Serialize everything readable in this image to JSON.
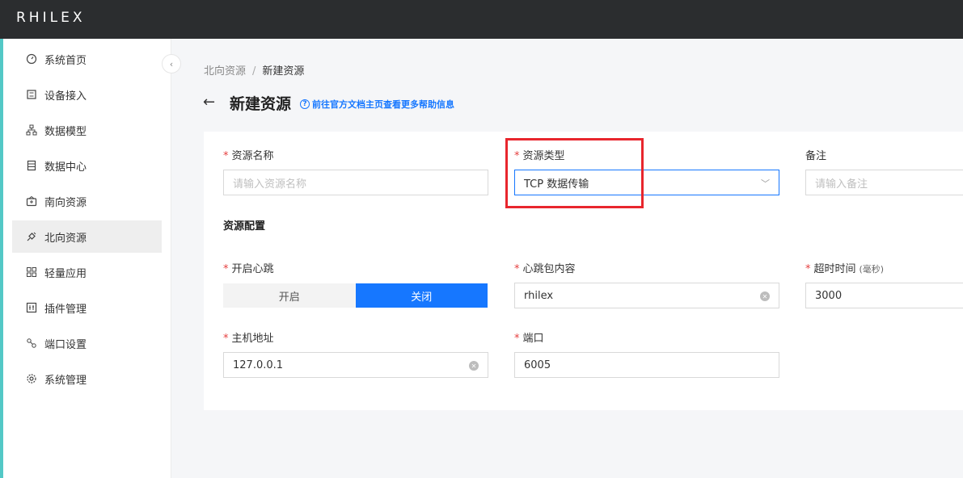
{
  "app": {
    "logo": "RHILEX"
  },
  "sidebar": {
    "items": [
      {
        "label": "系统首页",
        "icon": "dashboard-icon",
        "active": false
      },
      {
        "label": "设备接入",
        "icon": "device-icon",
        "active": false
      },
      {
        "label": "数据模型",
        "icon": "hierarchy-icon",
        "active": false
      },
      {
        "label": "数据中心",
        "icon": "database-icon",
        "active": false
      },
      {
        "label": "南向资源",
        "icon": "south-icon",
        "active": false
      },
      {
        "label": "北向资源",
        "icon": "plug-icon",
        "active": true
      },
      {
        "label": "轻量应用",
        "icon": "apps-icon",
        "active": false
      },
      {
        "label": "插件管理",
        "icon": "plugin-icon",
        "active": false
      },
      {
        "label": "端口设置",
        "icon": "port-icon",
        "active": false
      },
      {
        "label": "系统管理",
        "icon": "gear-icon",
        "active": false
      }
    ],
    "collapse_icon": "chevron-left-icon"
  },
  "breadcrumb": {
    "parent": "北向资源",
    "separator": "/",
    "current": "新建资源"
  },
  "header": {
    "title": "新建资源",
    "help_link": "前往官方文档主页查看更多帮助信息"
  },
  "form": {
    "name": {
      "label": "资源名称",
      "required": true,
      "placeholder": "请输入资源名称",
      "value": ""
    },
    "type": {
      "label": "资源类型",
      "required": true,
      "value": "TCP 数据传输"
    },
    "remark": {
      "label": "备注",
      "required": false,
      "placeholder": "请输入备注",
      "value": ""
    },
    "config_title": "资源配置",
    "heartbeat": {
      "label": "开启心跳",
      "required": true,
      "options": [
        "开启",
        "关闭"
      ],
      "selected": "关闭"
    },
    "heartbeat_content": {
      "label": "心跳包内容",
      "required": true,
      "value": "rhilex"
    },
    "timeout": {
      "label": "超时时间",
      "unit": "(毫秒)",
      "required": true,
      "value": "3000"
    },
    "host": {
      "label": "主机地址",
      "required": true,
      "value": "127.0.0.1"
    },
    "port": {
      "label": "端口",
      "required": true,
      "value": "6005"
    }
  },
  "colors": {
    "primary": "#1677ff",
    "topbar": "#2b2d2f",
    "accent": "#53c8c6",
    "required": "#e53e3e",
    "highlight": "#e8262d"
  }
}
